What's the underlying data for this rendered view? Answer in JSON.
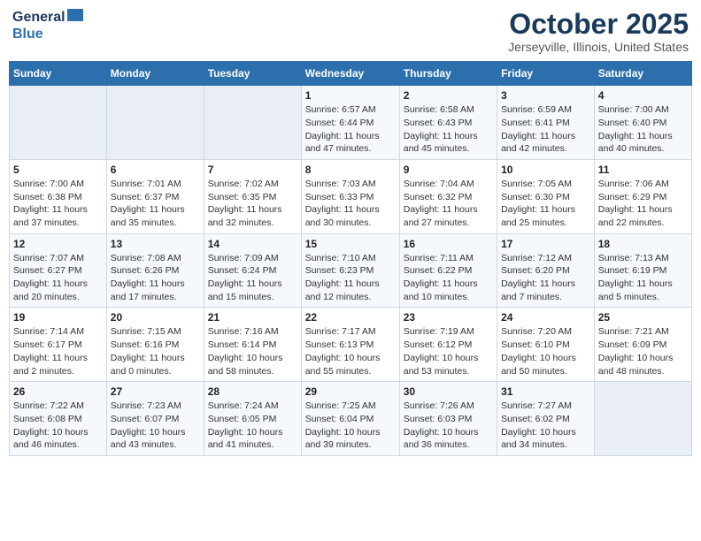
{
  "logo": {
    "line1": "General",
    "line2": "Blue"
  },
  "title": "October 2025",
  "subtitle": "Jerseyville, Illinois, United States",
  "weekdays": [
    "Sunday",
    "Monday",
    "Tuesday",
    "Wednesday",
    "Thursday",
    "Friday",
    "Saturday"
  ],
  "weeks": [
    [
      {
        "day": "",
        "info": ""
      },
      {
        "day": "",
        "info": ""
      },
      {
        "day": "",
        "info": ""
      },
      {
        "day": "1",
        "info": "Sunrise: 6:57 AM\nSunset: 6:44 PM\nDaylight: 11 hours and 47 minutes."
      },
      {
        "day": "2",
        "info": "Sunrise: 6:58 AM\nSunset: 6:43 PM\nDaylight: 11 hours and 45 minutes."
      },
      {
        "day": "3",
        "info": "Sunrise: 6:59 AM\nSunset: 6:41 PM\nDaylight: 11 hours and 42 minutes."
      },
      {
        "day": "4",
        "info": "Sunrise: 7:00 AM\nSunset: 6:40 PM\nDaylight: 11 hours and 40 minutes."
      }
    ],
    [
      {
        "day": "5",
        "info": "Sunrise: 7:00 AM\nSunset: 6:38 PM\nDaylight: 11 hours and 37 minutes."
      },
      {
        "day": "6",
        "info": "Sunrise: 7:01 AM\nSunset: 6:37 PM\nDaylight: 11 hours and 35 minutes."
      },
      {
        "day": "7",
        "info": "Sunrise: 7:02 AM\nSunset: 6:35 PM\nDaylight: 11 hours and 32 minutes."
      },
      {
        "day": "8",
        "info": "Sunrise: 7:03 AM\nSunset: 6:33 PM\nDaylight: 11 hours and 30 minutes."
      },
      {
        "day": "9",
        "info": "Sunrise: 7:04 AM\nSunset: 6:32 PM\nDaylight: 11 hours and 27 minutes."
      },
      {
        "day": "10",
        "info": "Sunrise: 7:05 AM\nSunset: 6:30 PM\nDaylight: 11 hours and 25 minutes."
      },
      {
        "day": "11",
        "info": "Sunrise: 7:06 AM\nSunset: 6:29 PM\nDaylight: 11 hours and 22 minutes."
      }
    ],
    [
      {
        "day": "12",
        "info": "Sunrise: 7:07 AM\nSunset: 6:27 PM\nDaylight: 11 hours and 20 minutes."
      },
      {
        "day": "13",
        "info": "Sunrise: 7:08 AM\nSunset: 6:26 PM\nDaylight: 11 hours and 17 minutes."
      },
      {
        "day": "14",
        "info": "Sunrise: 7:09 AM\nSunset: 6:24 PM\nDaylight: 11 hours and 15 minutes."
      },
      {
        "day": "15",
        "info": "Sunrise: 7:10 AM\nSunset: 6:23 PM\nDaylight: 11 hours and 12 minutes."
      },
      {
        "day": "16",
        "info": "Sunrise: 7:11 AM\nSunset: 6:22 PM\nDaylight: 11 hours and 10 minutes."
      },
      {
        "day": "17",
        "info": "Sunrise: 7:12 AM\nSunset: 6:20 PM\nDaylight: 11 hours and 7 minutes."
      },
      {
        "day": "18",
        "info": "Sunrise: 7:13 AM\nSunset: 6:19 PM\nDaylight: 11 hours and 5 minutes."
      }
    ],
    [
      {
        "day": "19",
        "info": "Sunrise: 7:14 AM\nSunset: 6:17 PM\nDaylight: 11 hours and 2 minutes."
      },
      {
        "day": "20",
        "info": "Sunrise: 7:15 AM\nSunset: 6:16 PM\nDaylight: 11 hours and 0 minutes."
      },
      {
        "day": "21",
        "info": "Sunrise: 7:16 AM\nSunset: 6:14 PM\nDaylight: 10 hours and 58 minutes."
      },
      {
        "day": "22",
        "info": "Sunrise: 7:17 AM\nSunset: 6:13 PM\nDaylight: 10 hours and 55 minutes."
      },
      {
        "day": "23",
        "info": "Sunrise: 7:19 AM\nSunset: 6:12 PM\nDaylight: 10 hours and 53 minutes."
      },
      {
        "day": "24",
        "info": "Sunrise: 7:20 AM\nSunset: 6:10 PM\nDaylight: 10 hours and 50 minutes."
      },
      {
        "day": "25",
        "info": "Sunrise: 7:21 AM\nSunset: 6:09 PM\nDaylight: 10 hours and 48 minutes."
      }
    ],
    [
      {
        "day": "26",
        "info": "Sunrise: 7:22 AM\nSunset: 6:08 PM\nDaylight: 10 hours and 46 minutes."
      },
      {
        "day": "27",
        "info": "Sunrise: 7:23 AM\nSunset: 6:07 PM\nDaylight: 10 hours and 43 minutes."
      },
      {
        "day": "28",
        "info": "Sunrise: 7:24 AM\nSunset: 6:05 PM\nDaylight: 10 hours and 41 minutes."
      },
      {
        "day": "29",
        "info": "Sunrise: 7:25 AM\nSunset: 6:04 PM\nDaylight: 10 hours and 39 minutes."
      },
      {
        "day": "30",
        "info": "Sunrise: 7:26 AM\nSunset: 6:03 PM\nDaylight: 10 hours and 36 minutes."
      },
      {
        "day": "31",
        "info": "Sunrise: 7:27 AM\nSunset: 6:02 PM\nDaylight: 10 hours and 34 minutes."
      },
      {
        "day": "",
        "info": ""
      }
    ]
  ]
}
